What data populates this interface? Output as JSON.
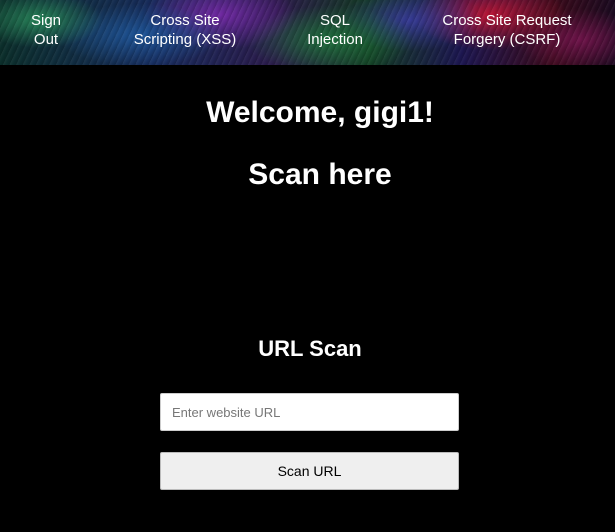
{
  "nav": {
    "sign_out": "Sign\nOut",
    "xss": "Cross Site\nScripting (XSS)",
    "sql": "SQL\nInjection",
    "csrf": "Cross Site Request\nForgery (CSRF)"
  },
  "main": {
    "welcome": "Welcome, gigi1!",
    "scan_here": "Scan here",
    "url_scan_title": "URL Scan",
    "url_input": {
      "placeholder": "Enter website URL",
      "value": ""
    },
    "scan_button_label": "Scan URL"
  }
}
